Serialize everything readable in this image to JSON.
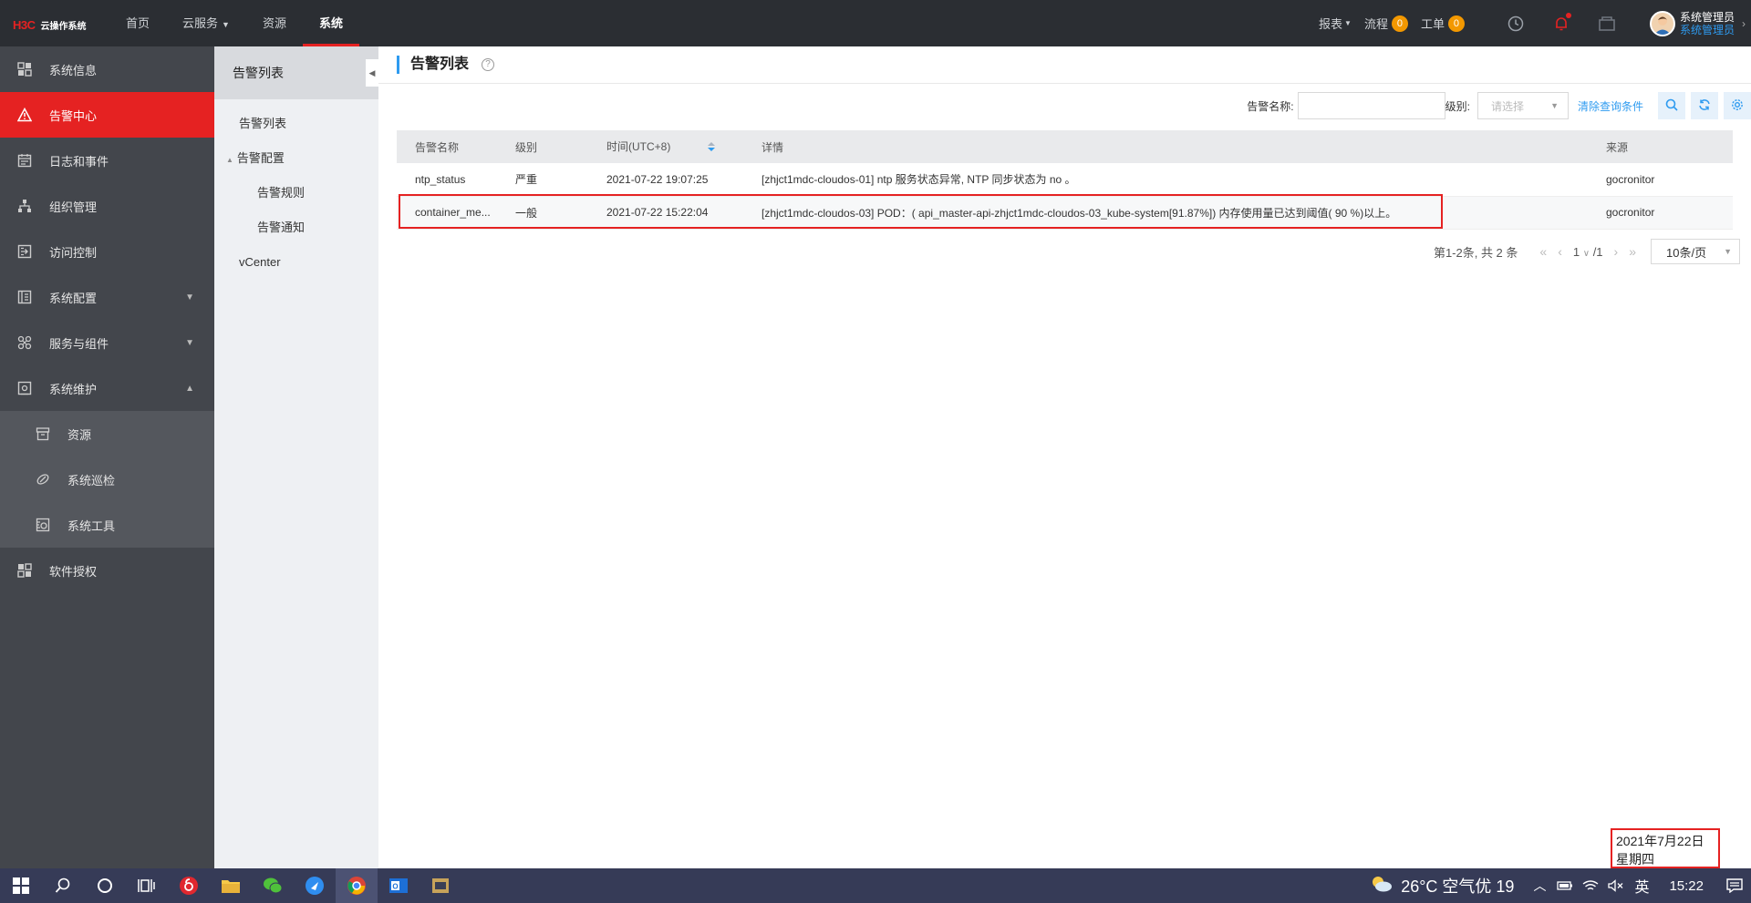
{
  "topbar": {
    "logo_mark": "H3C",
    "logo_text": "云操作系统",
    "nav": [
      {
        "label": "首页",
        "active": false,
        "caret": false
      },
      {
        "label": "云服务",
        "active": false,
        "caret": true
      },
      {
        "label": "资源",
        "active": false,
        "caret": false
      },
      {
        "label": "系统",
        "active": true,
        "caret": false
      }
    ],
    "reports_label": "报表",
    "flow_label": "流程",
    "flow_count": "0",
    "ticket_label": "工单",
    "ticket_count": "0",
    "user_name": "系统管理员",
    "user_role": "系统管理员",
    "badge_color": "#f39800",
    "accent_color": "#e52222"
  },
  "sidebar": {
    "items": [
      {
        "label": "系统信息",
        "icon": "dashboard-icon"
      },
      {
        "label": "告警中心",
        "icon": "warning-icon",
        "active": true
      },
      {
        "label": "日志和事件",
        "icon": "calendar-icon"
      },
      {
        "label": "组织管理",
        "icon": "org-tree-icon"
      },
      {
        "label": "访问控制",
        "icon": "access-icon"
      },
      {
        "label": "系统配置",
        "icon": "config-icon",
        "arrow": "down"
      },
      {
        "label": "服务与组件",
        "icon": "components-icon",
        "arrow": "down"
      },
      {
        "label": "系统维护",
        "icon": "maintenance-icon",
        "arrow": "up"
      }
    ],
    "sub_items": [
      {
        "label": "资源",
        "icon": "archive-icon"
      },
      {
        "label": "系统巡检",
        "icon": "inspect-icon"
      },
      {
        "label": "系统工具",
        "icon": "tools-icon"
      }
    ],
    "last_item": {
      "label": "软件授权",
      "icon": "license-icon"
    }
  },
  "subnav": {
    "header": "告警列表",
    "items": [
      {
        "label": "告警列表",
        "level": 1
      },
      {
        "label": "告警配置",
        "level": 0
      },
      {
        "label": "告警规则",
        "level": 2
      },
      {
        "label": "告警通知",
        "level": 2
      },
      {
        "label": "vCenter",
        "level": 1
      }
    ]
  },
  "main": {
    "title": "告警列表",
    "filter": {
      "name_label": "告警名称:",
      "name_value": "",
      "level_label": "级别:",
      "level_placeholder": "请选择",
      "clear_label": "清除查询条件"
    },
    "columns": [
      "告警名称",
      "级别",
      "时间(UTC+8)",
      "详情",
      "来源"
    ],
    "rows": [
      {
        "name": "ntp_status",
        "level": "严重",
        "time": "2021-07-22 19:07:25",
        "detail": "[zhjct1mdc-cloudos-01] ntp 服务状态异常, NTP 同步状态为 no 。",
        "source": "gocronitor"
      },
      {
        "name": "container_me...",
        "level": "一般",
        "time": "2021-07-22 15:22:04",
        "detail": "[zhjct1mdc-cloudos-03] POD：( api_master-api-zhjct1mdc-cloudos-03_kube-system[91.87%]) 内存使用量已达到阈值( 90 %)以上。",
        "source": "gocronitor"
      }
    ],
    "pager": {
      "info": "第1-2条, 共 2 条",
      "current": "1",
      "total": "/1",
      "page_size": "10条/页"
    }
  },
  "date_popup": {
    "date": "2021年7月22日",
    "weekday": "星期四"
  },
  "taskbar": {
    "weather": "26°C 空气优 19",
    "lang": "英",
    "time": "15:22",
    "bg_color": "#363b57"
  }
}
